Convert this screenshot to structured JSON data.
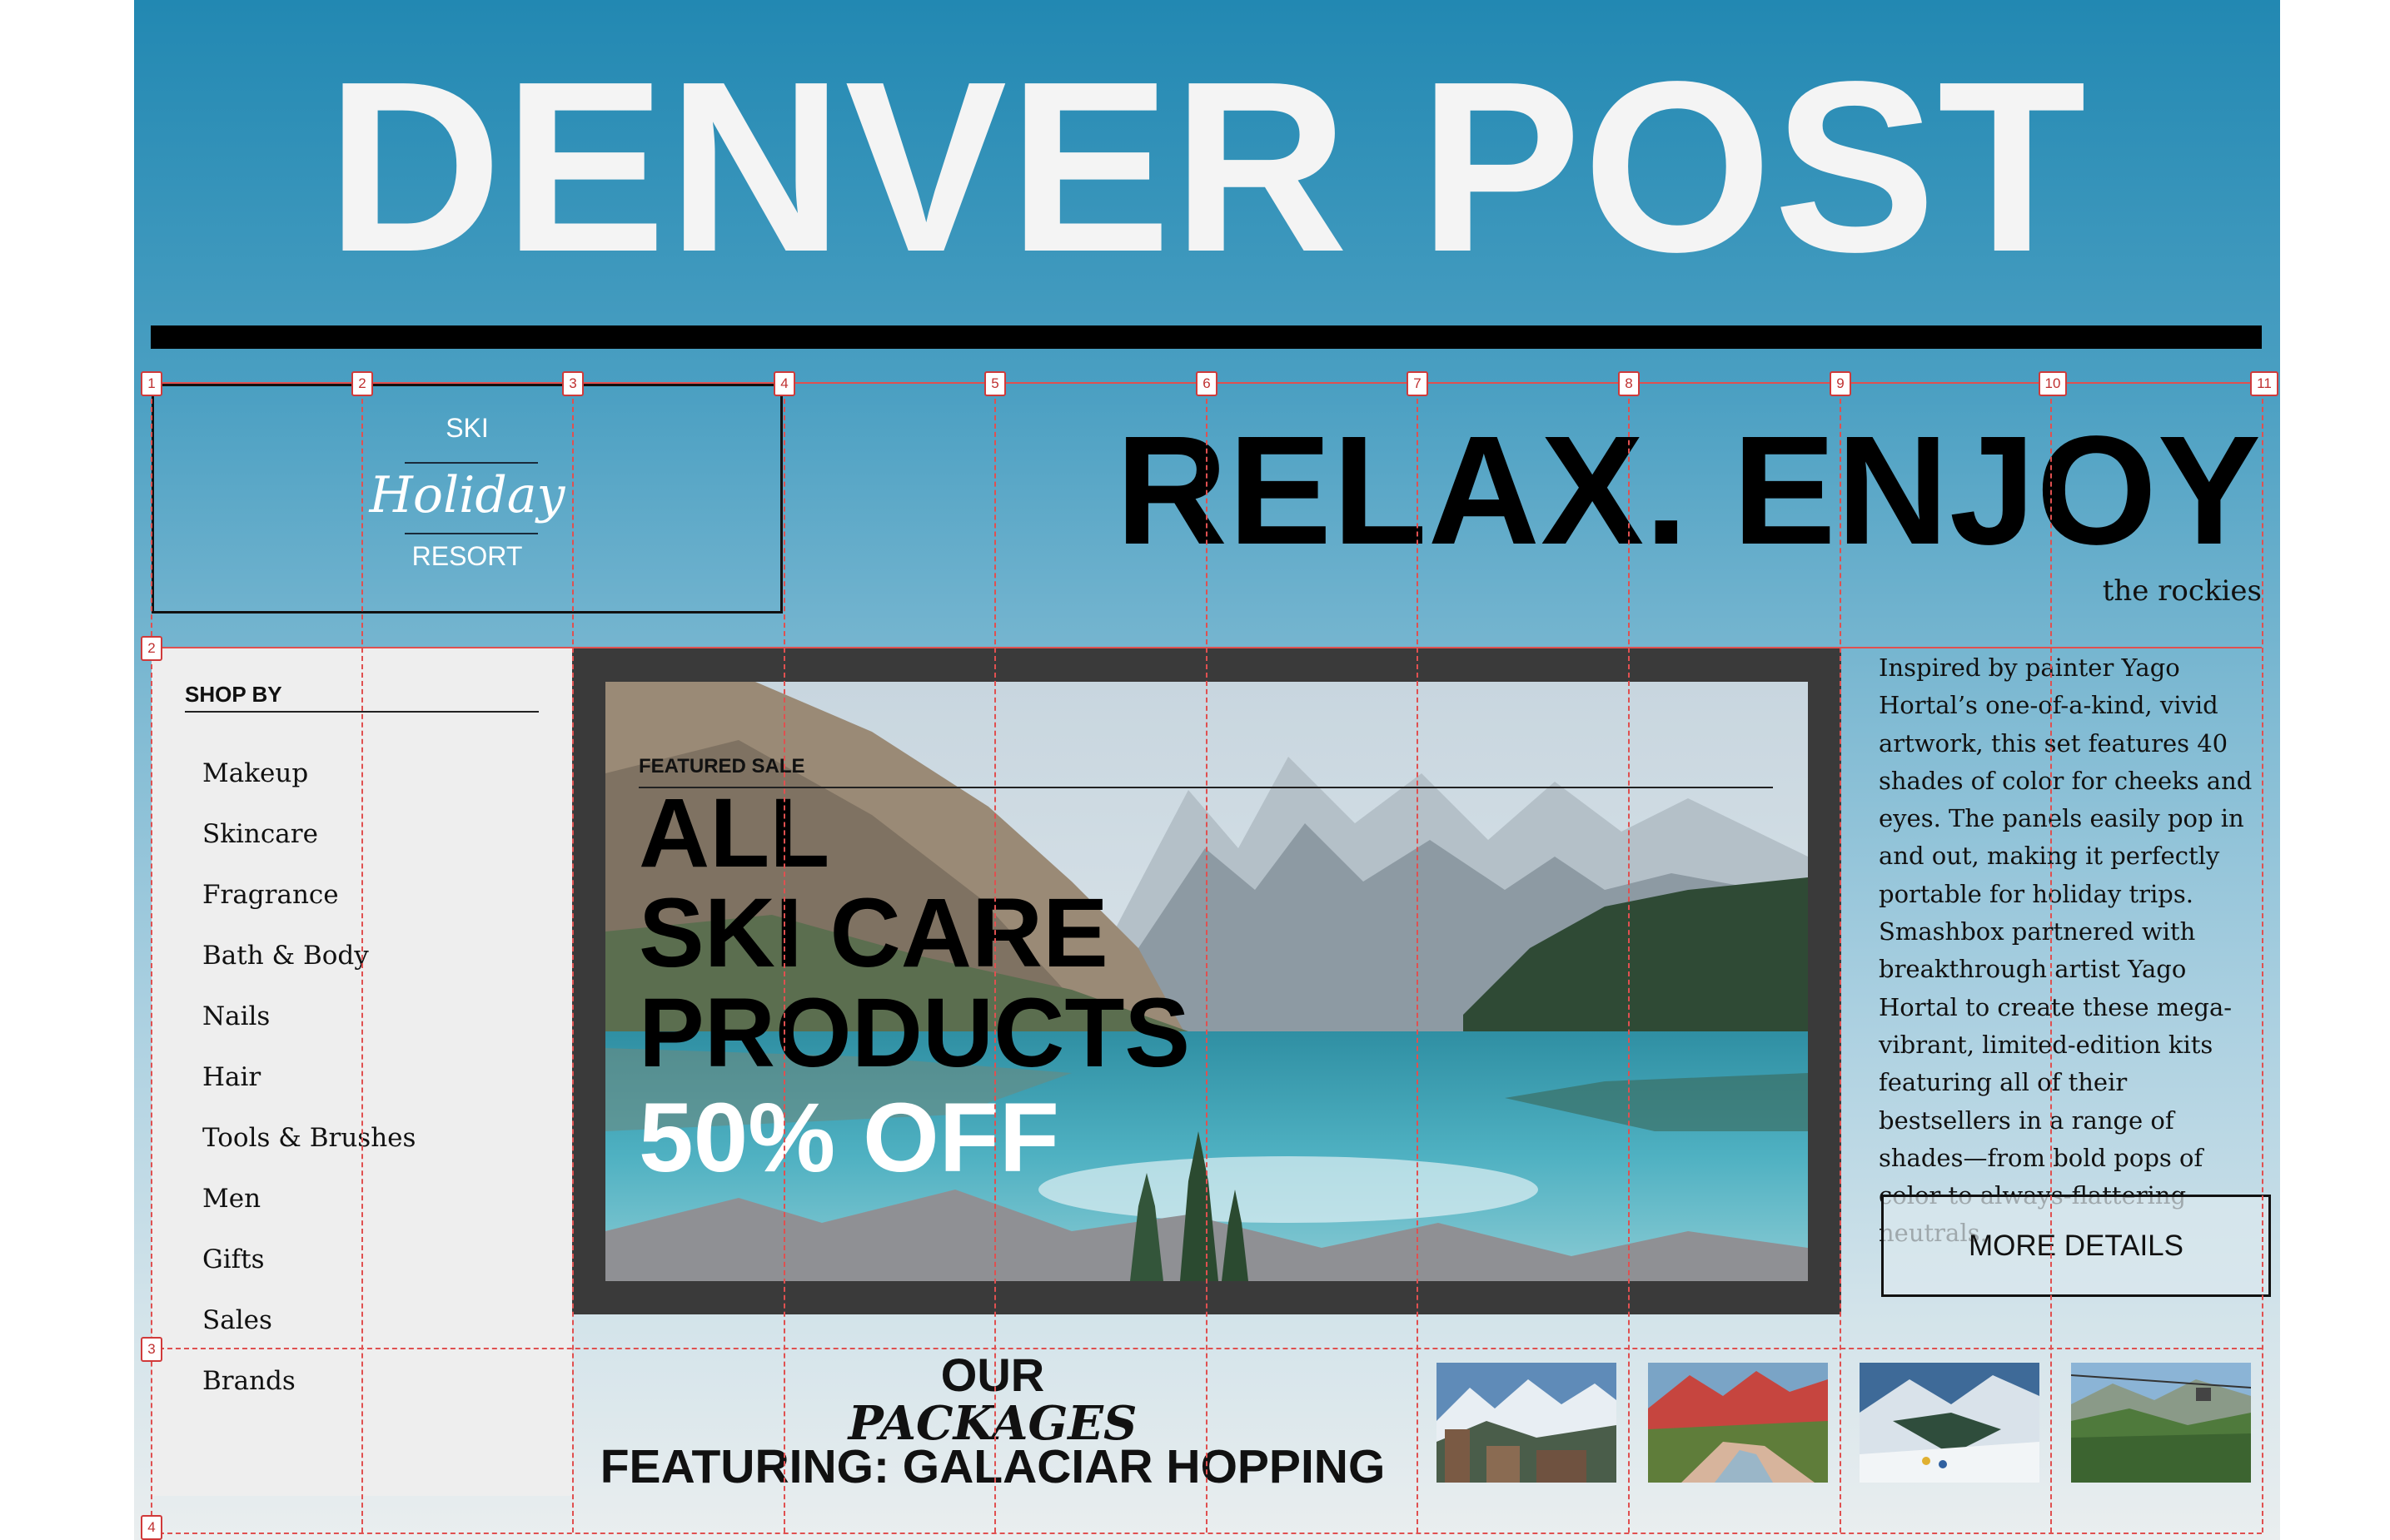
{
  "masthead": {
    "title": "DENVER POST"
  },
  "logo": {
    "top": "SKI",
    "middle": "Holiday",
    "bottom": "RESORT"
  },
  "hero_heading": {
    "title": "RELAX. ENJOY",
    "subtitle": "the rockies"
  },
  "sidebar": {
    "title": "SHOP BY",
    "items": [
      "Makeup",
      "Skincare",
      "Fragrance",
      "Bath & Body",
      "Nails",
      "Hair",
      "Tools & Brushes",
      "Men",
      "Gifts",
      "Sales",
      "Brands"
    ]
  },
  "hero": {
    "tag": "FEATURED SALE",
    "line1": "ALL",
    "line2": "SKI CARE",
    "line3": "PRODUCTS",
    "line4": "50% OFF"
  },
  "description": {
    "text": "Inspired by painter Yago Hortal’s one-of-a-kind, vivid artwork, this set features 40 shades of color for cheeks and eyes. The panels easily pop in and out, making it perfectly portable for holiday trips. Smashbox partnered with breakthrough artist Yago Hortal to create these mega-vibrant, limited-edition kits featuring all of their bestsellers in a range of shades—from bold pops of color to always-flattering neutrals.",
    "button": "MORE DETAILS"
  },
  "packages": {
    "line1": "OUR",
    "line2": "PACKAGES",
    "line3": "FEATURING: GALACIAR HOPPING",
    "thumbnails": [
      "mountain-town-photo",
      "red-peaks-river-photo",
      "skiers-valley-photo",
      "gondola-valley-photo"
    ]
  },
  "grid": {
    "column_labels": [
      "1",
      "2",
      "3",
      "4",
      "5",
      "6",
      "7",
      "8",
      "9",
      "10",
      "11"
    ],
    "row_labels": [
      "2",
      "3",
      "4"
    ]
  },
  "colors": {
    "header_blue": "#2288b2",
    "grid_red": "#e05050",
    "hero_frame": "#3a3a3a",
    "sidebar_bg": "#eeeeee"
  }
}
